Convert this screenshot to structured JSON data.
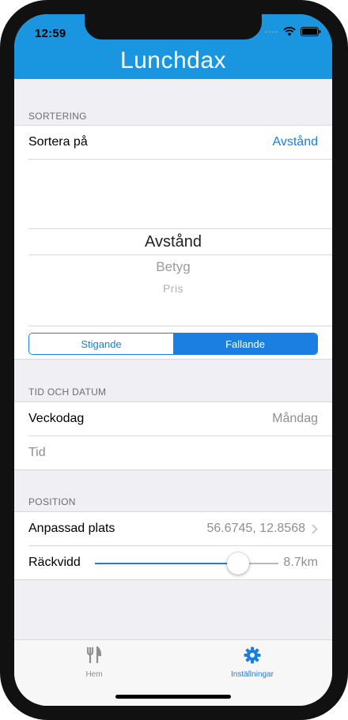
{
  "status": {
    "time": "12:59"
  },
  "nav": {
    "title": "Lunchdax"
  },
  "sorting": {
    "header": "SORTERING",
    "sort_label": "Sortera på",
    "sort_value": "Avstånd",
    "picker": [
      "Avstånd",
      "Betyg",
      "Pris"
    ],
    "order_options": [
      "Stigande",
      "Fallande"
    ],
    "order_selected": "Fallande"
  },
  "time": {
    "header": "TID OCH DATUM",
    "weekday_label": "Veckodag",
    "weekday_value": "Måndag",
    "time_label": "Tid"
  },
  "position": {
    "header": "POSITION",
    "custom_label": "Anpassad plats",
    "custom_value": "56.6745, 12.8568",
    "range_label": "Räckvidd",
    "range_value": "8.7km",
    "range_fraction": 0.78
  },
  "tabs": [
    {
      "label": "Hem",
      "icon": "fork-knife-icon",
      "active": false
    },
    {
      "label": "Inställningar",
      "icon": "gear-icon",
      "active": true
    }
  ],
  "colors": {
    "accent": "#1a7fe0",
    "navbar": "#1a95e0",
    "inactive": "#8e8e93"
  }
}
